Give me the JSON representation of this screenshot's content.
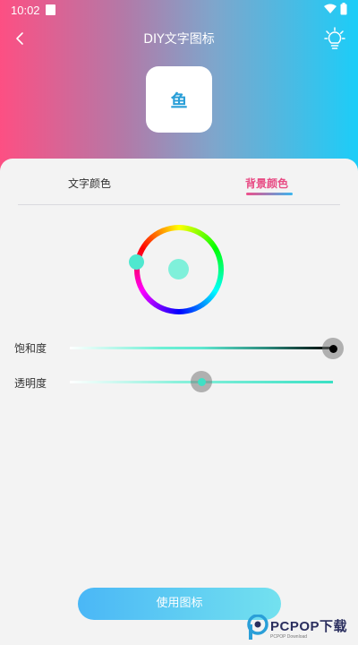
{
  "status_bar": {
    "time": "10:02"
  },
  "header": {
    "title": "DIY文字图标"
  },
  "preview": {
    "char": "鱼",
    "char_color": "#2a9fd8"
  },
  "tabs": [
    {
      "label": "文字颜色",
      "active": false
    },
    {
      "label": "背景颜色",
      "active": true
    }
  ],
  "colors": {
    "accent_pink": "#e84b84",
    "accent_blue": "#3ab6ef",
    "selected_color": "#5ee8d0",
    "header_left": "#fd4f83",
    "header_right": "#1ccdf8"
  },
  "sliders": {
    "saturation": {
      "label": "饱和度",
      "value": 1.0
    },
    "opacity": {
      "label": "透明度",
      "value": 0.5
    }
  },
  "actions": {
    "use_icon": "使用图标"
  },
  "watermark": {
    "brand": "PCPOP下载",
    "sub": "PCPOP Download"
  }
}
